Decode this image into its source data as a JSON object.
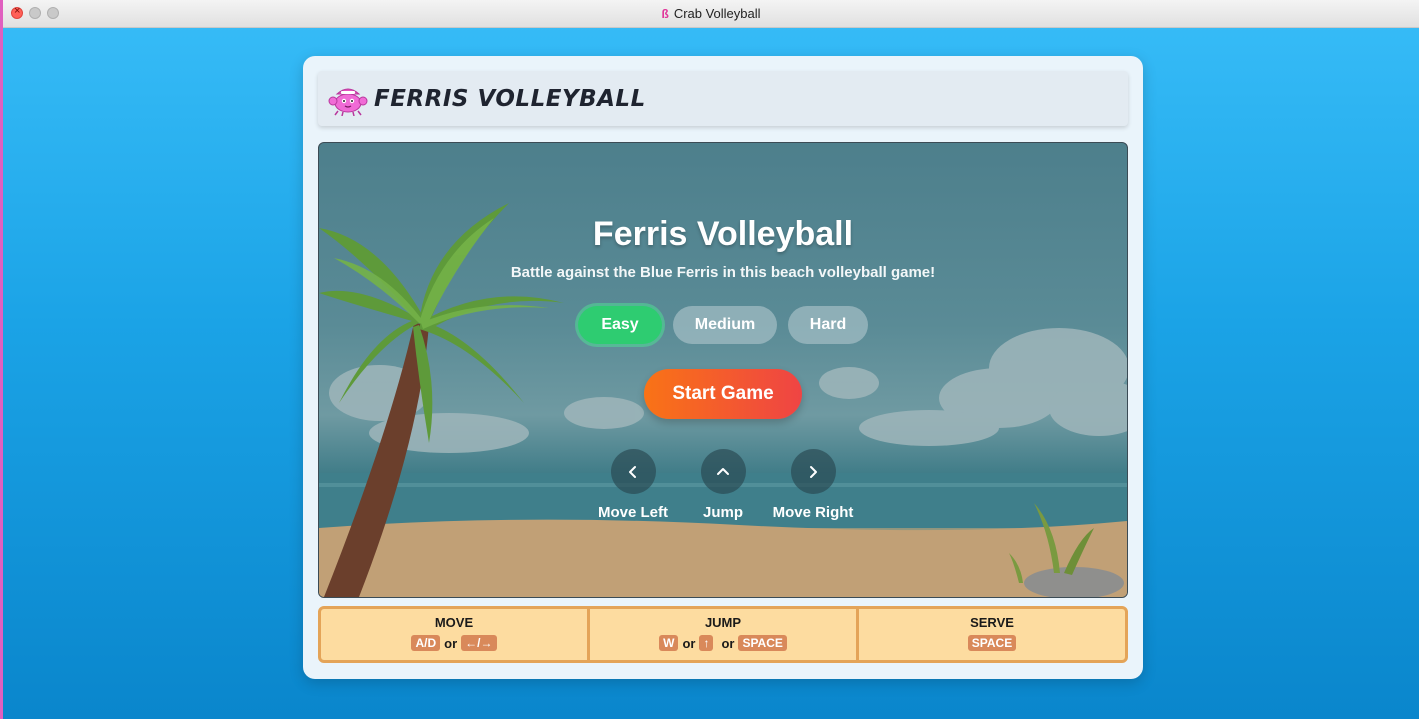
{
  "window": {
    "title": "Crab Volleyball"
  },
  "header": {
    "brand": "FERRIS VOLLEYBALL"
  },
  "game": {
    "title": "Ferris Volleyball",
    "subtitle": "Battle against the Blue Ferris in this beach volleyball game!",
    "difficulty": {
      "options": [
        "Easy",
        "Medium",
        "Hard"
      ],
      "selected": "Easy"
    },
    "start_label": "Start Game",
    "controls": [
      {
        "label": "Move Left",
        "icon": "chevron-left-icon"
      },
      {
        "label": "Jump",
        "icon": "chevron-up-icon"
      },
      {
        "label": "Move Right",
        "icon": "chevron-right-icon"
      }
    ]
  },
  "keybindings": {
    "move": {
      "title": "MOVE",
      "key1": "A/D",
      "or": "or",
      "key2": "←/→"
    },
    "jump": {
      "title": "JUMP",
      "key1": "W",
      "or1": "or",
      "key2": "↑",
      "or2": "or",
      "key3": "SPACE"
    },
    "serve": {
      "title": "SERVE",
      "key1": "SPACE"
    }
  },
  "colors": {
    "accent_easy": "#2ecc71",
    "start_gradient": [
      "#f97316",
      "#ef4444"
    ],
    "keys_bg": "#fddca0",
    "keys_border": "#e4a458",
    "kbd_bg": "#d9895a"
  }
}
